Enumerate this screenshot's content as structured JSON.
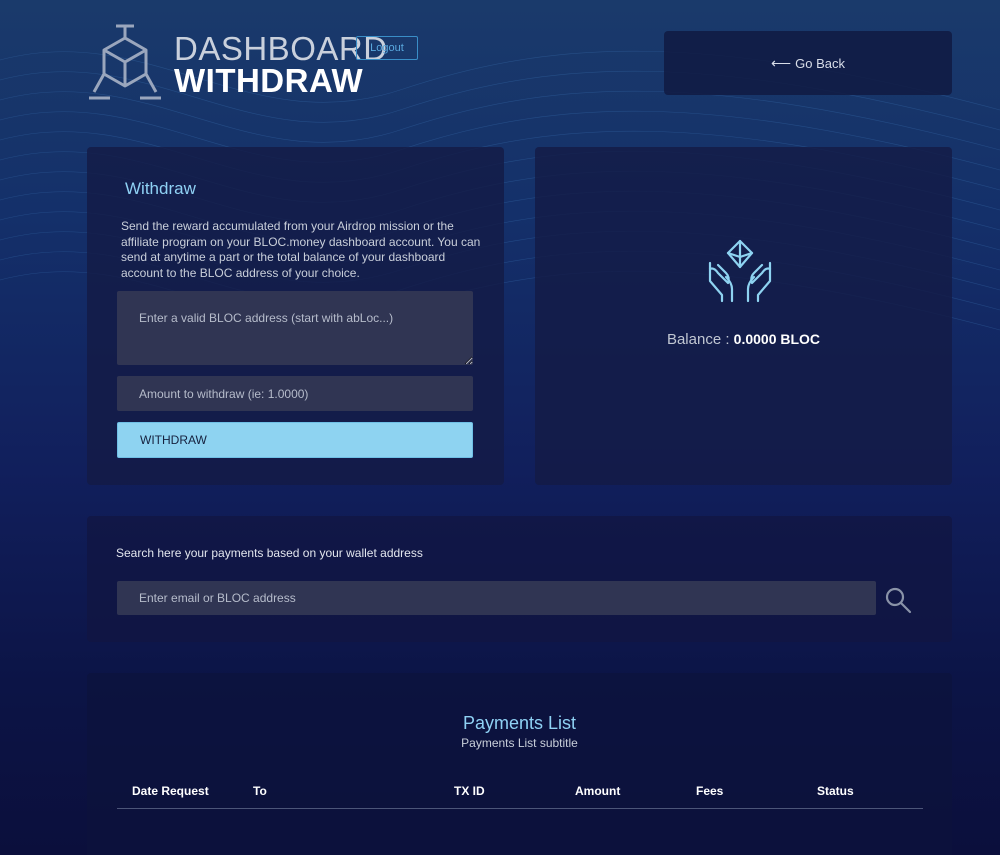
{
  "header": {
    "title_line1": "DASHBOARD",
    "title_line2": "WITHDRAW",
    "logout_label": "Logout",
    "go_back_label": "Go Back"
  },
  "withdraw": {
    "title": "Withdraw",
    "description": "Send the reward accumulated from your Airdrop mission or the affiliate program on your BLOC.money dashboard account. You can send at anytime a part or the total balance of your dashboard account to the BLOC address of your choice.",
    "address_placeholder": "Enter a valid BLOC address (start with abLoc...)",
    "amount_placeholder": "Amount to withdraw (ie: 1.0000)",
    "button_label": "WITHDRAW"
  },
  "balance": {
    "label": "Balance : ",
    "value": "0.0000 BLOC",
    "icon": "hands-diamond-icon"
  },
  "search": {
    "label": "Search here your payments based on your wallet address",
    "placeholder": "Enter email or BLOC address",
    "icon": "search-icon"
  },
  "payments": {
    "title": "Payments List",
    "subtitle": "Payments List subtitle",
    "columns": [
      "Date Request",
      "To",
      "TX ID",
      "Amount",
      "Fees",
      "Status"
    ],
    "rows": []
  },
  "colors": {
    "accent": "#8ed3f1",
    "logout_border": "#3a8ec7",
    "input_bg": "#303553"
  }
}
